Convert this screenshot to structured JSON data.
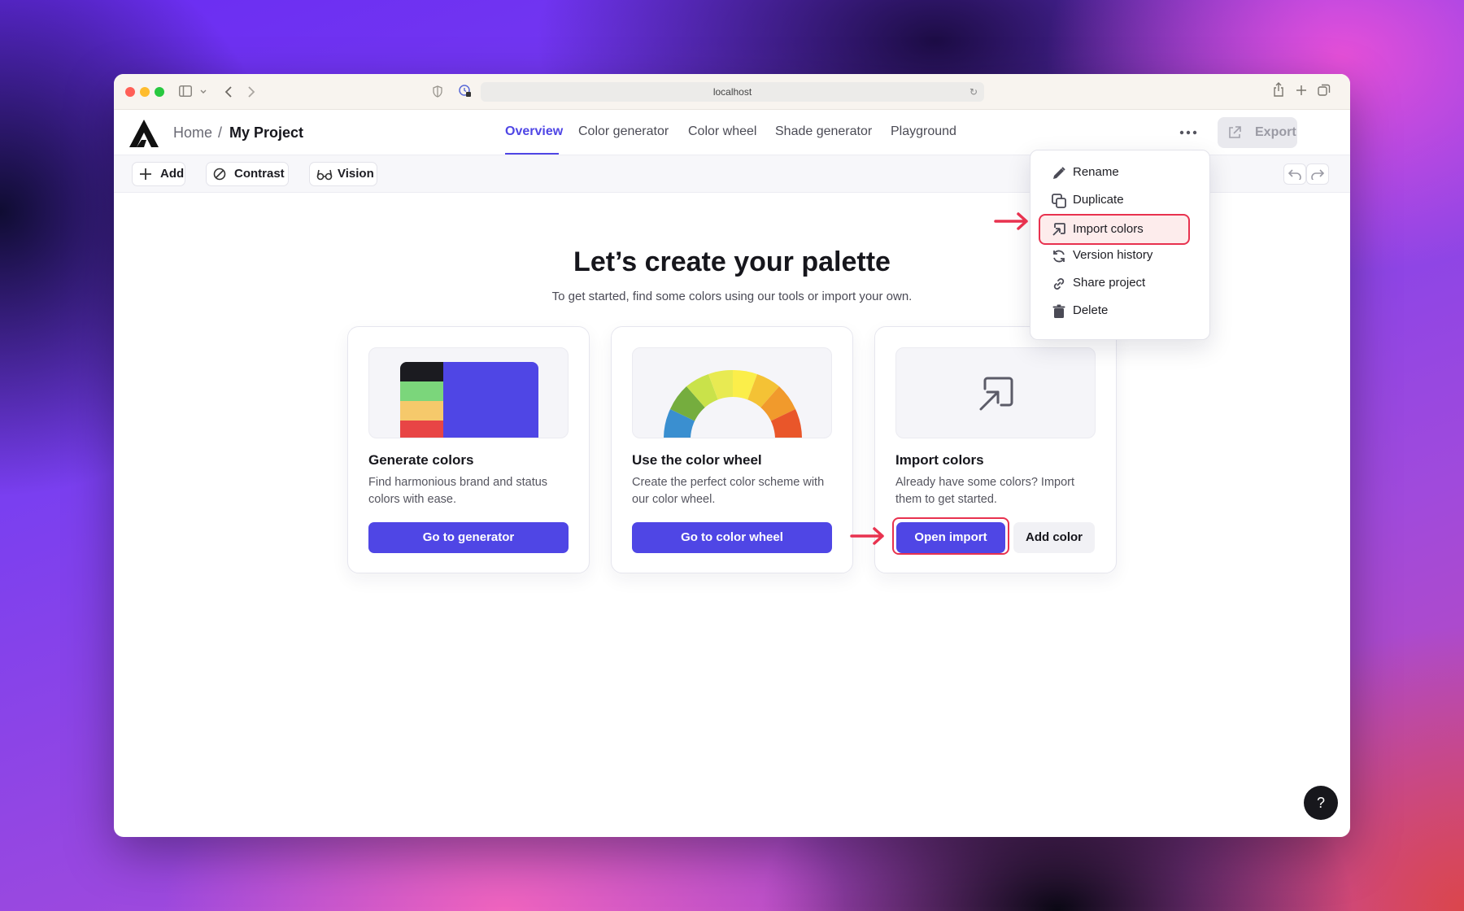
{
  "browser": {
    "url": "localhost"
  },
  "header": {
    "breadcrumb_home": "Home",
    "breadcrumb_sep": "/",
    "breadcrumb_project": "My Project",
    "tabs": [
      {
        "label": "Overview",
        "active": true
      },
      {
        "label": "Color generator"
      },
      {
        "label": "Color wheel"
      },
      {
        "label": "Shade generator"
      },
      {
        "label": "Playground"
      }
    ],
    "export_label": "Export"
  },
  "toolbar": {
    "add_label": "Add",
    "contrast_label": "Contrast",
    "vision_label": "Vision"
  },
  "main": {
    "title": "Let’s create your palette",
    "subtitle": "To get started, find some colors using our tools or import your own.",
    "cards": [
      {
        "title": "Generate colors",
        "description": "Find harmonious brand and status colors with ease.",
        "button": "Go to generator"
      },
      {
        "title": "Use the color wheel",
        "description": "Create the perfect color scheme with our color wheel.",
        "button": "Go to color wheel"
      },
      {
        "title": "Import colors",
        "description": "Already have some colors? Import them to get started.",
        "button": "Open import",
        "secondary_button": "Add color"
      }
    ]
  },
  "menu": {
    "items": [
      {
        "label": "Rename",
        "icon": "pencil-icon"
      },
      {
        "label": "Duplicate",
        "icon": "duplicate-icon"
      },
      {
        "label": "Import colors",
        "icon": "import-icon",
        "highlighted": true
      },
      {
        "label": "Version history",
        "icon": "history-icon"
      },
      {
        "label": "Share project",
        "icon": "link-icon"
      },
      {
        "label": "Delete",
        "icon": "trash-icon"
      }
    ]
  },
  "help_label": "?",
  "colors": {
    "accent": "#4f46e5",
    "highlight": "#e8324f"
  }
}
